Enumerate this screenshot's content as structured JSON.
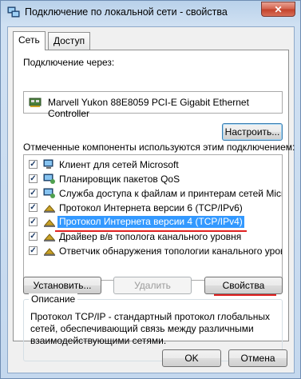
{
  "window": {
    "title": "Подключение по локальной сети - свойства",
    "close_glyph": "✕"
  },
  "tabs": [
    {
      "label": "Сеть",
      "active": true
    },
    {
      "label": "Доступ",
      "active": false
    }
  ],
  "connect_using": {
    "label": "Подключение через:",
    "adapter": "Marvell Yukon 88E8059 PCI-E Gigabit Ethernet Controller",
    "configure_button": "Настроить..."
  },
  "components": {
    "label": "Отмеченные компоненты используются этим подключением:",
    "items": [
      {
        "label": "Клиент для сетей Microsoft",
        "checked": true,
        "icon": "network-client-icon"
      },
      {
        "label": "Планировщик пакетов QoS",
        "checked": true,
        "icon": "network-service-icon"
      },
      {
        "label": "Служба доступа к файлам и принтерам сетей Micro...",
        "checked": true,
        "icon": "network-service-icon"
      },
      {
        "label": "Протокол Интернета версии 6 (TCP/IPv6)",
        "checked": true,
        "icon": "protocol-icon"
      },
      {
        "label": "Протокол Интернета версии 4 (TCP/IPv4)",
        "checked": true,
        "icon": "protocol-icon",
        "selected": true
      },
      {
        "label": "Драйвер в/в тополога канального уровня",
        "checked": true,
        "icon": "protocol-icon"
      },
      {
        "label": "Ответчик обнаружения топологии канального уровня",
        "checked": true,
        "icon": "protocol-icon"
      }
    ]
  },
  "buttons": {
    "install": "Установить...",
    "uninstall": "Удалить",
    "properties": "Свойства",
    "ok": "OK",
    "cancel": "Отмена"
  },
  "description": {
    "title": "Описание",
    "text": "Протокол TCP/IP - стандартный протокол глобальных сетей, обеспечивающий связь между различными взаимодействующими сетями."
  },
  "colors": {
    "selection": "#3399ff",
    "annotation": "#e02020"
  }
}
